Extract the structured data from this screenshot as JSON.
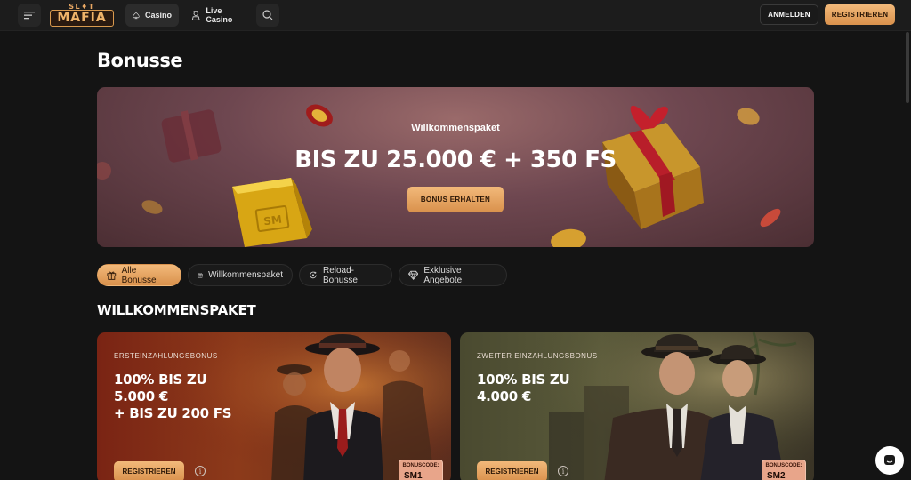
{
  "header": {
    "logo_top": "SL♦T",
    "logo_main": "MAFIA",
    "tabs": [
      {
        "label": "Casino",
        "icon": "spade-icon",
        "active": true
      },
      {
        "label": "Live Casino",
        "icon": "dealer-icon",
        "active": false
      }
    ],
    "login_label": "ANMELDEN",
    "register_label": "REGISTRIEREN"
  },
  "page": {
    "title": "Bonusse"
  },
  "hero": {
    "subtitle": "Willkommenspaket",
    "title": "BIS ZU 25.000 € + 350 FS",
    "button_label": "BONUS ERHALTEN",
    "bar_mark": "SM"
  },
  "filters": [
    {
      "label": "Alle Bonusse",
      "icon": "gift-icon",
      "active": true
    },
    {
      "label": "Willkommenspaket",
      "icon": "gift-icon",
      "active": false
    },
    {
      "label": "Reload-Bonusse",
      "icon": "reload-icon",
      "active": false
    },
    {
      "label": "Exklusive Angebote",
      "icon": "diamond-icon",
      "active": false
    }
  ],
  "section": {
    "title": "WILLKOMMENSPAKET"
  },
  "cards": [
    {
      "eyebrow": "ERSTEINZAHLUNGSBONUS",
      "title_line1": "100% BIS ZU 5.000 €",
      "title_line2": "+ BIS ZU 200 FS",
      "button_label": "REGISTRIEREN",
      "code_label": "BONUSCODE:",
      "code": "SM1"
    },
    {
      "eyebrow": "ZWEITER EINZAHLUNGSBONUS",
      "title_line1": "100% BIS ZU",
      "title_line2": "4.000 €",
      "button_label": "REGISTRIEREN",
      "code_label": "BONUSCODE:",
      "code": "SM2"
    }
  ],
  "colors": {
    "accent": "#e9a864",
    "background": "#141414",
    "header": "#1c1c1c"
  }
}
